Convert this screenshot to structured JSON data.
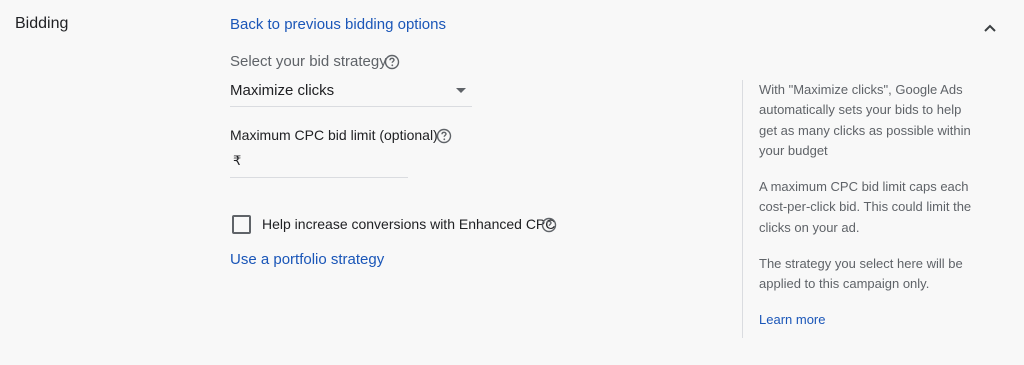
{
  "section": {
    "title": "Bidding",
    "back_link": "Back to previous bidding options",
    "collapse_icon": "chevron-up-icon"
  },
  "bid_strategy": {
    "label": "Select your bid strategy",
    "selected": "Maximize clicks",
    "help_icon": "help-circle-icon"
  },
  "max_cpc": {
    "label": "Maximum CPC bid limit (optional)",
    "currency": "₹",
    "value": "",
    "help_icon": "help-circle-icon"
  },
  "enhanced_cpc": {
    "label": "Help increase conversions with Enhanced CPC",
    "checked": false,
    "help_icon": "help-circle-icon"
  },
  "portfolio_link": "Use a portfolio strategy",
  "sidebar": {
    "paragraph1": "With \"Maximize clicks\", Google Ads automatically sets your bids to help get as many clicks as possible within your budget",
    "paragraph2": "A maximum CPC bid limit caps each cost-per-click bid. This could limit the clicks on your ad.",
    "paragraph3": "The strategy you select here will be applied to this campaign only.",
    "learn_more": "Learn more"
  },
  "colors": {
    "link": "#1a56b8",
    "text_primary": "#202124",
    "text_secondary": "#5f6368",
    "background": "#f8f8f8",
    "divider": "#dadce0"
  }
}
